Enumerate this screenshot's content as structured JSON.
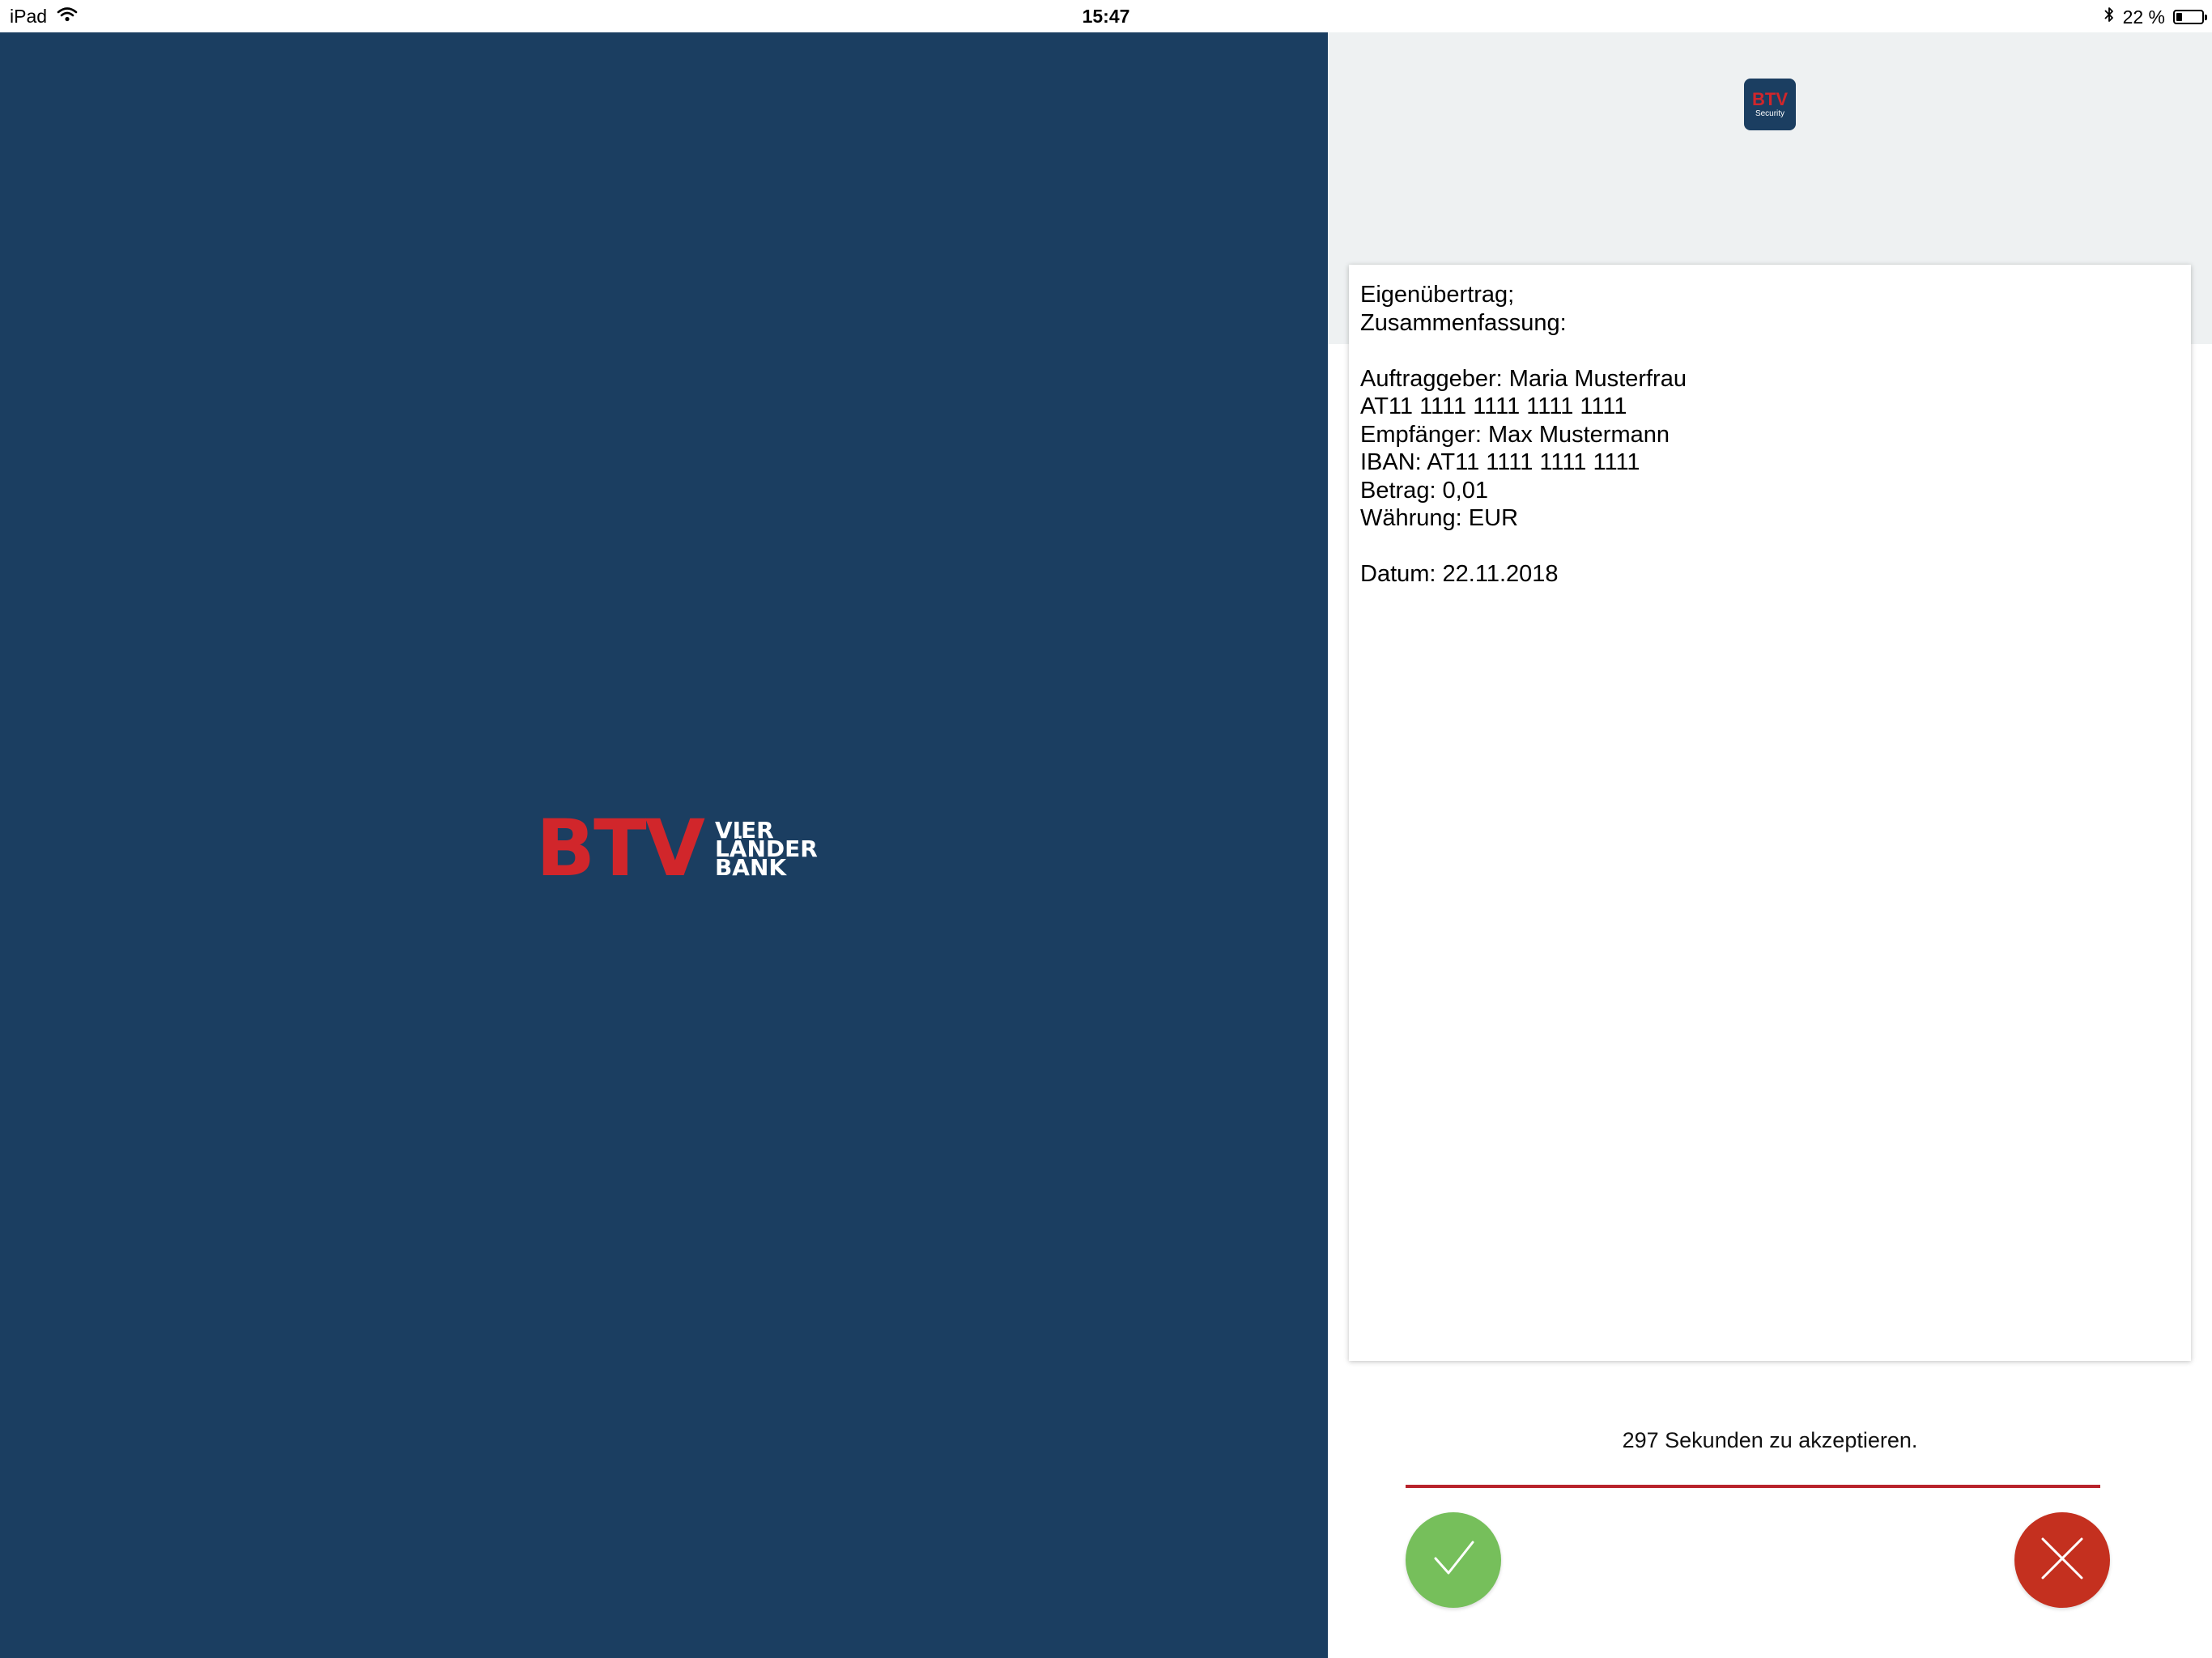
{
  "status_bar": {
    "device": "iPad",
    "time": "15:47",
    "battery_text": "22 %",
    "battery_level": 0.22
  },
  "left": {
    "brand": {
      "main": "BTV",
      "line1": "VIER",
      "line2": "LÄNDER",
      "line3": "BANK"
    }
  },
  "right": {
    "app_icon": {
      "main": "BTV",
      "sub": "Security"
    },
    "transaction": {
      "title": "Eigenübertrag;",
      "subtitle": "Zusammenfassung:",
      "auftraggeber": "Auftraggeber: Maria Musterfrau",
      "auftraggeber_iban": "AT11 1111 1111 1111 1111",
      "empfaenger": "Empfänger: Max Mustermann",
      "iban": "IBAN: AT11 1111 1111 1111",
      "betrag": "Betrag: 0,01",
      "waehrung": "Währung: EUR",
      "datum": "Datum: 22.11.2018"
    },
    "countdown_text": "297 Sekunden zu akzeptieren.",
    "countdown_progress": 1.0
  },
  "icons": {
    "wifi": "wifi-icon",
    "bluetooth": "bluetooth-icon",
    "battery": "battery-icon",
    "accept": "checkmark-icon",
    "decline": "close-icon"
  },
  "colors": {
    "brand_navy": "#1b3e61",
    "brand_red": "#d1262b",
    "accept_green": "#76bf5b",
    "decline_red": "#c4301f",
    "progress_red": "#b8232b",
    "header_gray": "#eef1f2"
  }
}
